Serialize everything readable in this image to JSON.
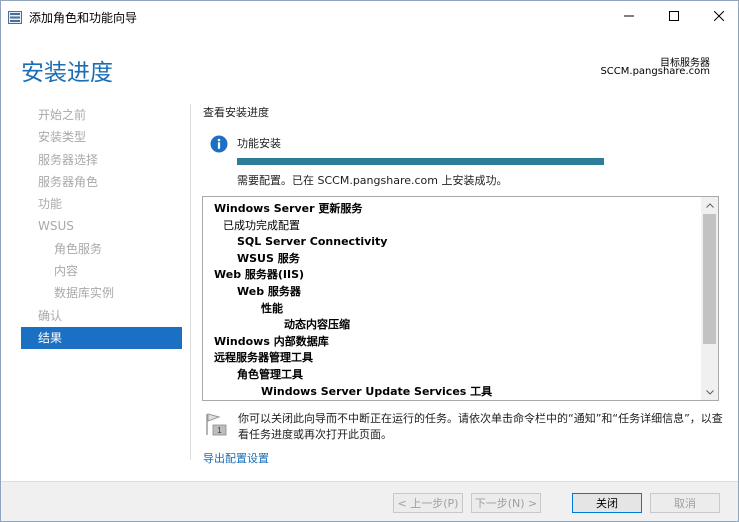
{
  "window": {
    "title": "添加角色和功能向导",
    "controls": [
      "minimize-icon",
      "maximize-icon",
      "close-icon"
    ]
  },
  "header": {
    "page_title": "安装进度",
    "destination_label": "目标服务器",
    "destination_server": "SCCM.pangshare.com"
  },
  "nav": {
    "items": [
      {
        "label": "开始之前"
      },
      {
        "label": "安装类型"
      },
      {
        "label": "服务器选择"
      },
      {
        "label": "服务器角色"
      },
      {
        "label": "功能"
      },
      {
        "label": "WSUS"
      },
      {
        "label": "角色服务"
      },
      {
        "label": "内容"
      },
      {
        "label": "数据库实例"
      },
      {
        "label": "确认"
      },
      {
        "label": "结果"
      }
    ],
    "active": "结果"
  },
  "content": {
    "section_title": "查看安装进度",
    "feature_label": "功能安装",
    "progress_percent": 100,
    "status_message": "需要配置。已在 SCCM.pangshare.com 上安装成功。",
    "results": [
      {
        "text": "Windows Server 更新服务",
        "bold": true,
        "level": 0
      },
      {
        "text": "已成功完成配置",
        "bold": false,
        "level": 1
      },
      {
        "text": "SQL Server Connectivity",
        "bold": true,
        "level": 2
      },
      {
        "text": "WSUS 服务",
        "bold": true,
        "level": 2
      },
      {
        "text": "Web 服务器(IIS)",
        "bold": true,
        "level": 0
      },
      {
        "text": "Web 服务器",
        "bold": true,
        "level": 2
      },
      {
        "text": "性能",
        "bold": true,
        "level": 3
      },
      {
        "text": "动态内容压缩",
        "bold": true,
        "level": 4
      },
      {
        "text": "Windows 内部数据库",
        "bold": true,
        "level": 0
      },
      {
        "text": "远程服务器管理工具",
        "bold": true,
        "level": 0
      },
      {
        "text": "角色管理工具",
        "bold": true,
        "level": 2
      },
      {
        "text": "Windows Server Update Services 工具",
        "bold": true,
        "level": 3
      }
    ],
    "notice": "你可以关闭此向导而不中断正在运行的任务。请依次单击命令栏中的“通知”和“任务详细信息”，以查看任务进度或再次打开此页面。",
    "export_link": "导出配置设置"
  },
  "footer": {
    "prev": "< 上一步(P)",
    "next": "下一步(N) >",
    "close": "关闭",
    "cancel": "取消"
  },
  "colors": {
    "accent": "#1a6eb4",
    "nav_active_bg": "#1c70c4",
    "progress_fill": "#2d7d9a",
    "nav_inactive_text": "#a9a9a9"
  }
}
